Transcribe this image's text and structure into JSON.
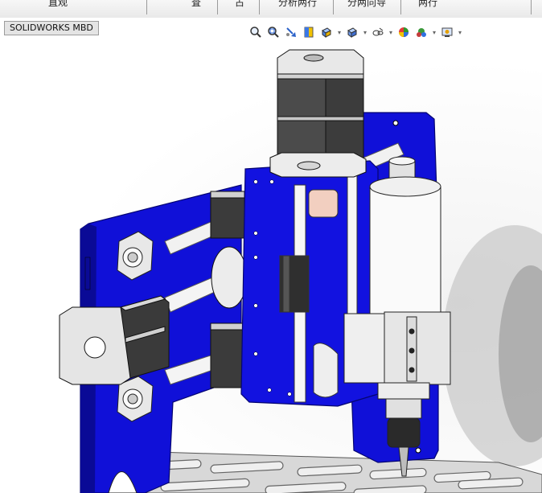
{
  "ribbon": {
    "tabs": [
      {
        "label": "直观"
      },
      {
        "label": "査"
      },
      {
        "label": "占"
      },
      {
        "label": "分析两行"
      },
      {
        "label": "分两向导"
      },
      {
        "label": "两行"
      }
    ]
  },
  "viewport": {
    "mbd_tab_label": "SOLIDWORKS MBD"
  },
  "heads_up_toolbar": {
    "icons": [
      "zoom-to-fit-icon",
      "zoom-to-area-icon",
      "previous-view-icon",
      "section-view-icon",
      "view-orientation-icon",
      "display-style-icon",
      "hide-show-items-icon",
      "edit-appearance-icon",
      "apply-scene-icon",
      "view-settings-icon"
    ]
  },
  "colors": {
    "frame_blue": "#1010d8",
    "frame_blue_dark": "#0a0a96",
    "motor_dark": "#3a3a3a",
    "metal_light": "#e6e6e6",
    "rail_white": "#f4f4f4",
    "bed_gray": "#d7d7d7"
  }
}
